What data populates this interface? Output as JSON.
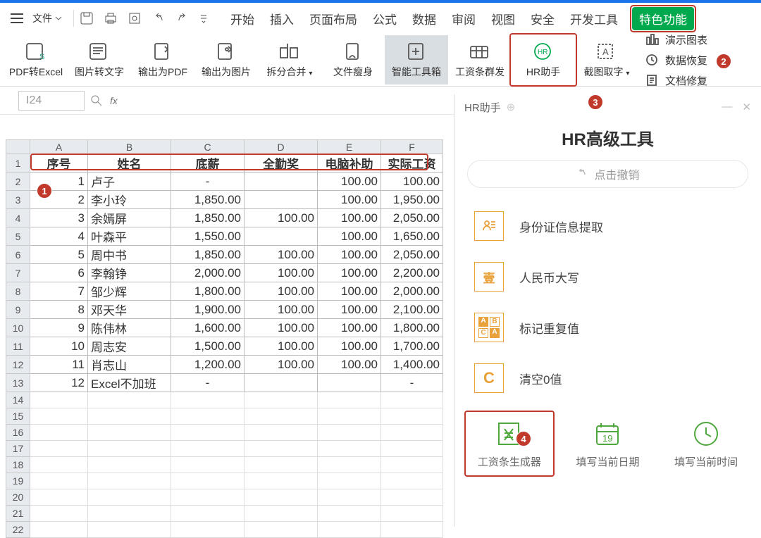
{
  "menu": {
    "file": "文件"
  },
  "tabs": [
    "开始",
    "插入",
    "页面布局",
    "公式",
    "数据",
    "审阅",
    "视图",
    "安全",
    "开发工具",
    "特色功能"
  ],
  "ribbon": {
    "items": [
      {
        "label": "PDF转Excel"
      },
      {
        "label": "图片转文字"
      },
      {
        "label": "输出为PDF"
      },
      {
        "label": "输出为图片"
      },
      {
        "label": "拆分合并"
      },
      {
        "label": "文件瘦身"
      },
      {
        "label": "智能工具箱"
      },
      {
        "label": "工资条群发"
      },
      {
        "label": "HR助手"
      },
      {
        "label": "截图取字"
      }
    ],
    "right": [
      "演示图表",
      "数据恢复",
      "文档修复"
    ]
  },
  "cellname": "I24",
  "panel": {
    "title": "HR助手",
    "heading": "HR高级工具",
    "undo": "点击撤销",
    "tools": [
      "身份证信息提取",
      "人民币大写",
      "标记重复值",
      "清空0值"
    ],
    "bottom": [
      "工资条生成器",
      "填写当前日期",
      "填写当前时间"
    ],
    "cal_day": "19"
  },
  "sheet": {
    "cols": [
      "A",
      "B",
      "C",
      "D",
      "E",
      "F"
    ],
    "widths": [
      82,
      118,
      104,
      104,
      90,
      88
    ],
    "headers": [
      "序号",
      "姓名",
      "底薪",
      "全勤奖",
      "电脑补助",
      "实际工资"
    ],
    "rows": [
      [
        "1",
        "卢子",
        "-",
        "",
        "100.00",
        "100.00"
      ],
      [
        "2",
        "李小玲",
        "1,850.00",
        "",
        "100.00",
        "1,950.00"
      ],
      [
        "3",
        "余嫣屏",
        "1,850.00",
        "100.00",
        "100.00",
        "2,050.00"
      ],
      [
        "4",
        "叶森平",
        "1,550.00",
        "",
        "100.00",
        "1,650.00"
      ],
      [
        "5",
        "周中书",
        "1,850.00",
        "100.00",
        "100.00",
        "2,050.00"
      ],
      [
        "6",
        "李翰铮",
        "2,000.00",
        "100.00",
        "100.00",
        "2,200.00"
      ],
      [
        "7",
        "邹少辉",
        "1,800.00",
        "100.00",
        "100.00",
        "2,000.00"
      ],
      [
        "8",
        "邓天华",
        "1,900.00",
        "100.00",
        "100.00",
        "2,100.00"
      ],
      [
        "9",
        "陈伟林",
        "1,600.00",
        "100.00",
        "100.00",
        "1,800.00"
      ],
      [
        "10",
        "周志安",
        "1,500.00",
        "100.00",
        "100.00",
        "1,700.00"
      ],
      [
        "11",
        "肖志山",
        "1,200.00",
        "100.00",
        "100.00",
        "1,400.00"
      ],
      [
        "12",
        "Excel不加班",
        "-",
        "",
        "",
        "-"
      ]
    ],
    "chart_data": {
      "type": "table",
      "headers": [
        "序号",
        "姓名",
        "底薪",
        "全勤奖",
        "电脑补助",
        "实际工资"
      ],
      "rows": [
        [
          1,
          "卢子",
          null,
          null,
          100.0,
          100.0
        ],
        [
          2,
          "李小玲",
          1850.0,
          null,
          100.0,
          1950.0
        ],
        [
          3,
          "余嫣屏",
          1850.0,
          100.0,
          100.0,
          2050.0
        ],
        [
          4,
          "叶森平",
          1550.0,
          null,
          100.0,
          1650.0
        ],
        [
          5,
          "周中书",
          1850.0,
          100.0,
          100.0,
          2050.0
        ],
        [
          6,
          "李翰铮",
          2000.0,
          100.0,
          100.0,
          2200.0
        ],
        [
          7,
          "邹少辉",
          1800.0,
          100.0,
          100.0,
          2000.0
        ],
        [
          8,
          "邓天华",
          1900.0,
          100.0,
          100.0,
          2100.0
        ],
        [
          9,
          "陈伟林",
          1600.0,
          100.0,
          100.0,
          1800.0
        ],
        [
          10,
          "周志安",
          1500.0,
          100.0,
          100.0,
          1700.0
        ],
        [
          11,
          "肖志山",
          1200.0,
          100.0,
          100.0,
          1400.0
        ],
        [
          12,
          "Excel不加班",
          null,
          null,
          null,
          null
        ]
      ]
    }
  }
}
